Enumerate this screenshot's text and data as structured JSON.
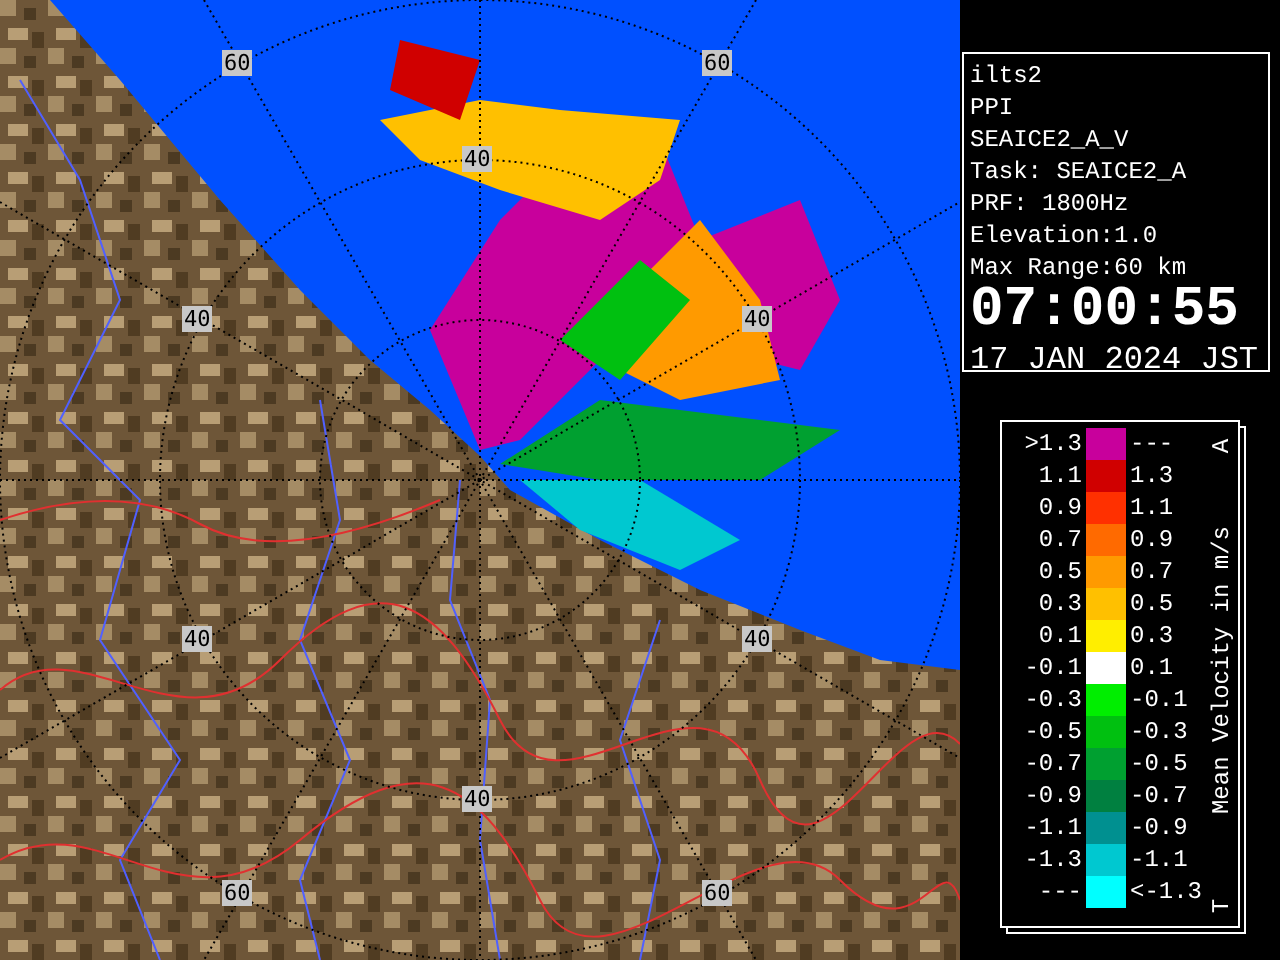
{
  "map": {
    "range_labels": [
      "60",
      "60",
      "40",
      "40",
      "40",
      "40",
      "40",
      "40",
      "60",
      "60"
    ]
  },
  "info_panel": {
    "lines": [
      "ilts2",
      "PPI",
      "SEAICE2_A_V",
      "Task: SEAICE2_A",
      "PRF: 1800Hz",
      "Elevation:1.0",
      "Max Range:60 km"
    ],
    "time": "07:00:55",
    "date": "17 JAN 2024 JST"
  },
  "legend": {
    "top_mark": "A",
    "unit_label": "Mean Velocity in m/s",
    "bottom_mark": "T",
    "rows": [
      {
        "upper": ">1.3",
        "lower": "---",
        "color": "#c8009c"
      },
      {
        "upper": "1.1",
        "lower": "1.3",
        "color": "#d00000"
      },
      {
        "upper": "0.9",
        "lower": "1.1",
        "color": "#ff3000"
      },
      {
        "upper": "0.7",
        "lower": "0.9",
        "color": "#ff6a00"
      },
      {
        "upper": "0.5",
        "lower": "0.7",
        "color": "#ff9a00"
      },
      {
        "upper": "0.3",
        "lower": "0.5",
        "color": "#ffc000"
      },
      {
        "upper": "0.1",
        "lower": "0.3",
        "color": "#ffee00"
      },
      {
        "upper": "-0.1",
        "lower": "0.1",
        "color": "#ffffff"
      },
      {
        "upper": "-0.3",
        "lower": "-0.1",
        "color": "#00ee00"
      },
      {
        "upper": "-0.5",
        "lower": "-0.3",
        "color": "#00c010"
      },
      {
        "upper": "-0.7",
        "lower": "-0.5",
        "color": "#00a030"
      },
      {
        "upper": "-0.9",
        "lower": "-0.7",
        "color": "#008040"
      },
      {
        "upper": "-1.1",
        "lower": "-0.9",
        "color": "#009090"
      },
      {
        "upper": "-1.3",
        "lower": "-1.1",
        "color": "#00c8d0"
      },
      {
        "upper": "---",
        "lower": "<-1.3",
        "color": "#00ffff"
      }
    ]
  }
}
